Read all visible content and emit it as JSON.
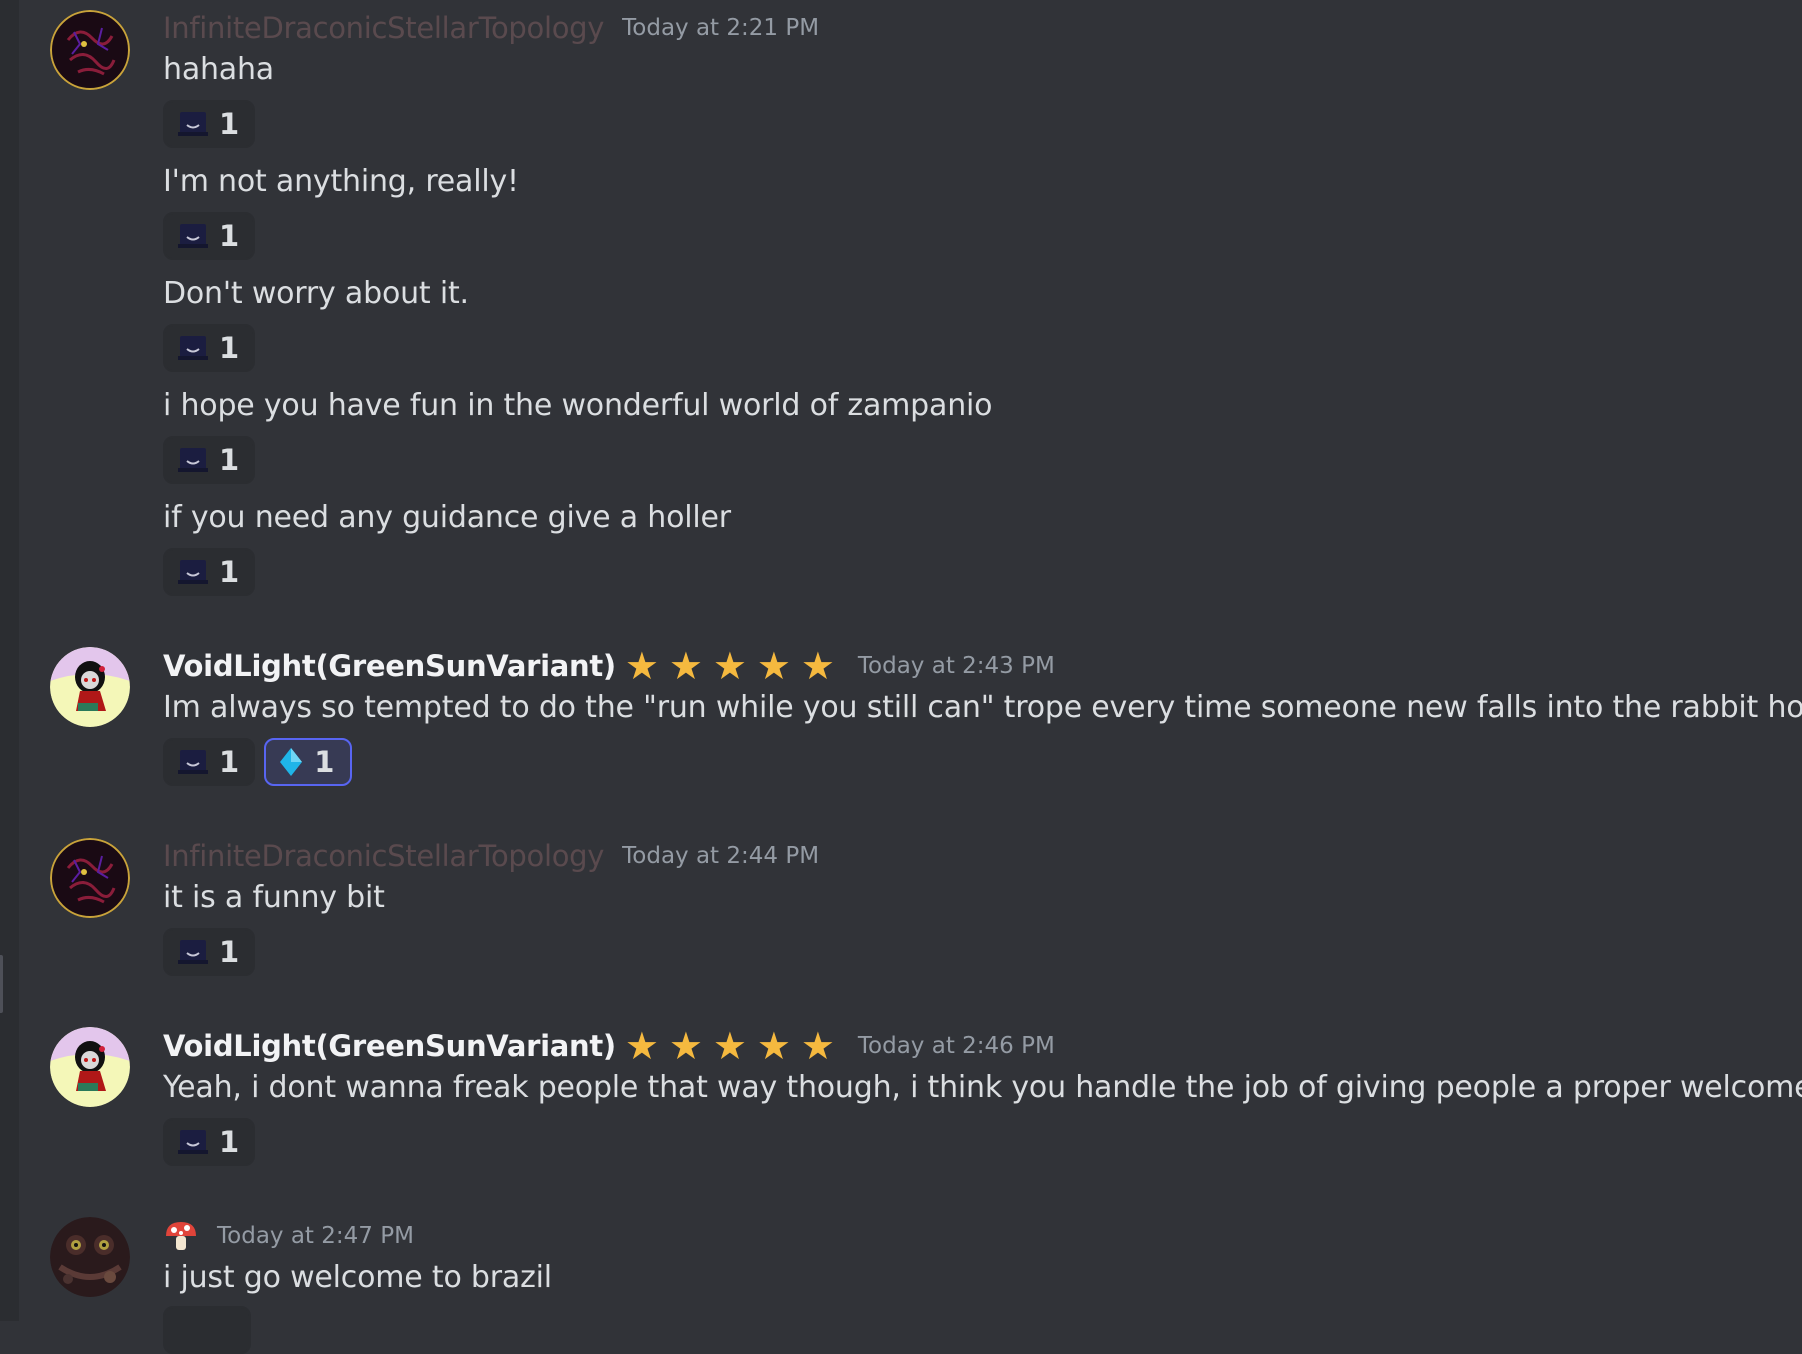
{
  "messages": [
    {
      "author": "InfiniteDraconicStellarTopology",
      "timestamp": "Today at 2:21 PM",
      "lines": [
        {
          "text": "hahaha",
          "reaction_count": "1"
        },
        {
          "text": "I'm not anything, really!",
          "reaction_count": "1"
        },
        {
          "text": "Don't worry about it.",
          "reaction_count": "1"
        },
        {
          "text": "i hope you have fun in the wonderful world of zampanio",
          "reaction_count": "1"
        },
        {
          "text": "if you need any guidance give a holler",
          "reaction_count": "1"
        }
      ]
    },
    {
      "author": "VoidLight(GreenSunVariant)",
      "stars": [
        "★",
        "★",
        "★",
        "★",
        "★"
      ],
      "timestamp": "Today at 2:43 PM",
      "text": "Im always so tempted to do the \"run while you still can\" trope every time someone new falls into the rabbit hole",
      "reactions": [
        {
          "emoji": "hat-emoji",
          "count": "1",
          "active": false
        },
        {
          "emoji": "blue-diamond-emoji",
          "count": "1",
          "active": true
        }
      ]
    },
    {
      "author": "InfiniteDraconicStellarTopology",
      "timestamp": "Today at 2:44 PM",
      "text": "it is a funny bit",
      "reaction_count": "1"
    },
    {
      "author": "VoidLight(GreenSunVariant)",
      "stars": [
        "★",
        "★",
        "★",
        "★",
        "★"
      ],
      "timestamp": "Today at 2:46 PM",
      "text": "Yeah, i dont wanna freak people that way though, i think you handle the job of giving people a proper welcome",
      "reaction_count": "1"
    },
    {
      "author_icon": "mushroom-emoji",
      "timestamp": "Today at 2:47 PM",
      "text": "i just go welcome to brazil"
    }
  ],
  "colors": {
    "background": "#313338",
    "dim_username": "#5a4a4e",
    "timestamp": "#949ba4",
    "star": "#f5b93f",
    "active_reaction_border": "#5865f2"
  }
}
